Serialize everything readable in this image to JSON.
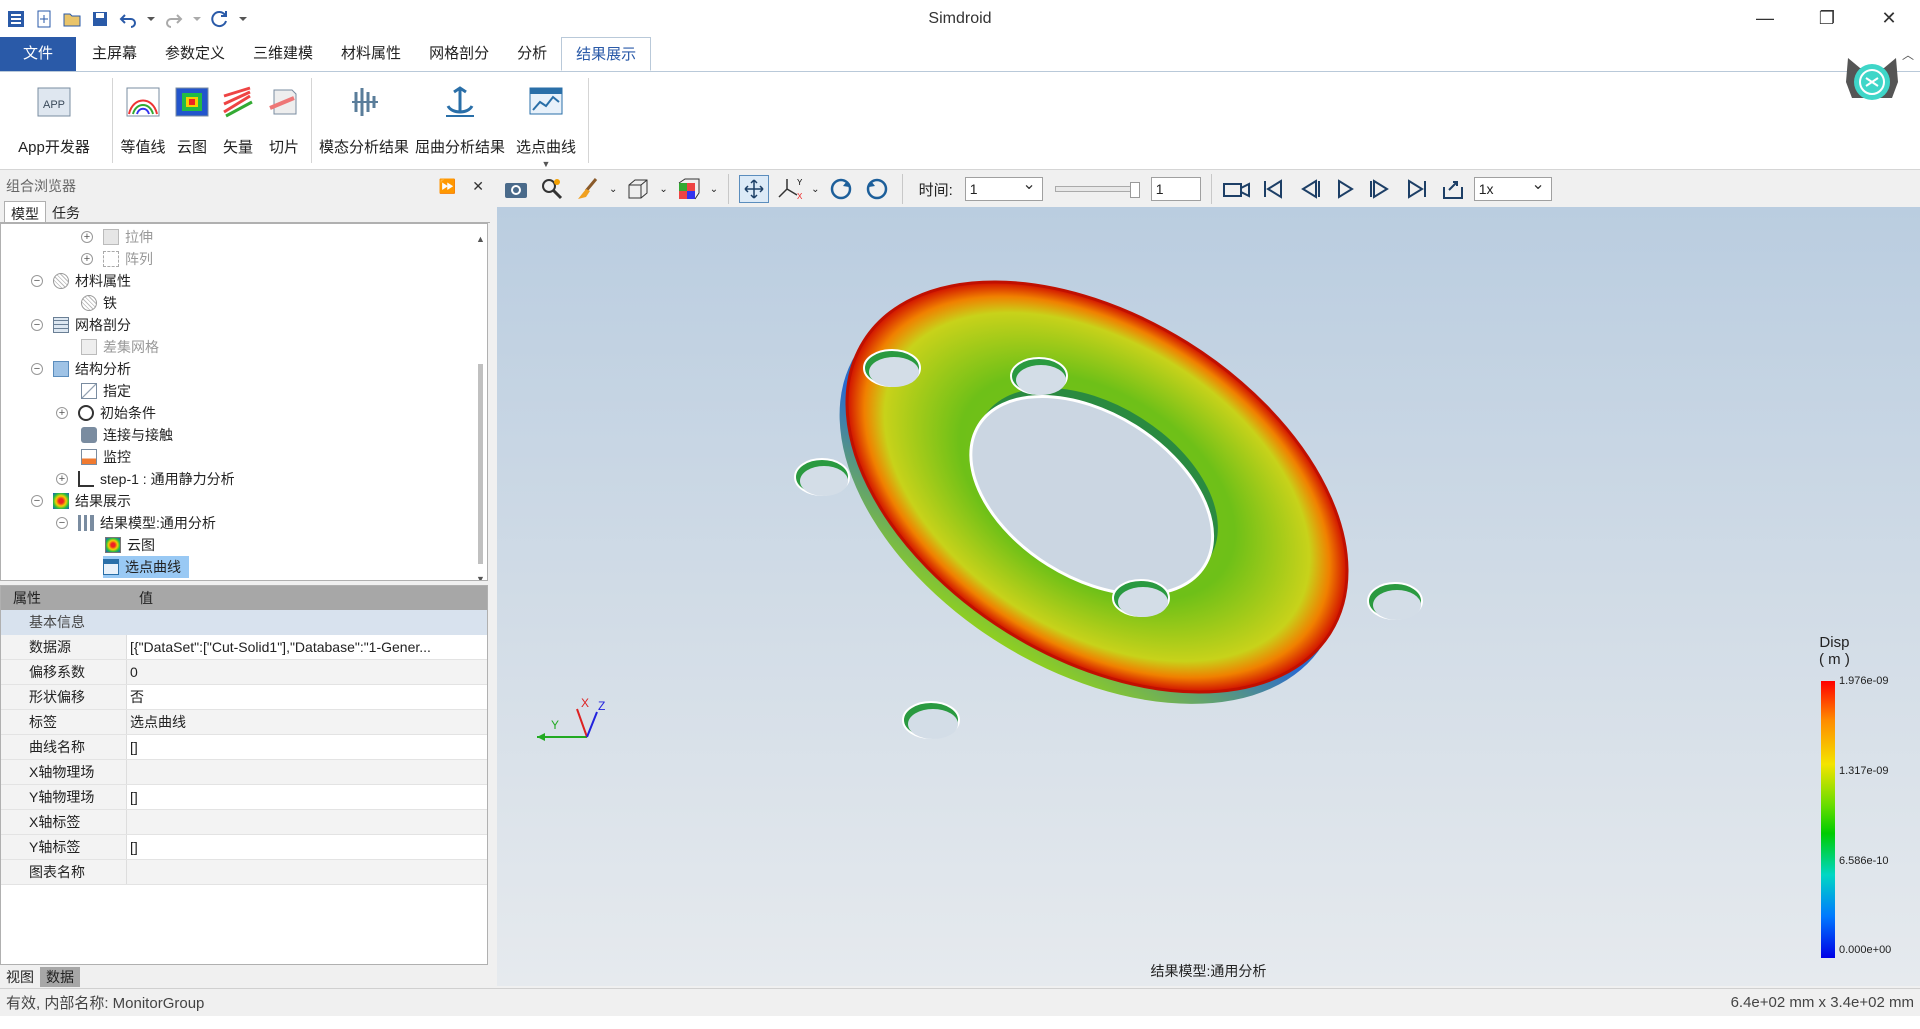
{
  "window": {
    "title": "Simdroid"
  },
  "menu_tabs": [
    "文件",
    "主屏幕",
    "参数定义",
    "三维建模",
    "材料属性",
    "网格剖分",
    "分析",
    "结果展示"
  ],
  "ribbon": {
    "buttons": [
      "App开发器",
      "等值线",
      "云图",
      "矢量",
      "切片",
      "模态分析结果",
      "屈曲分析结果",
      "选点曲线"
    ]
  },
  "left_panel": {
    "title": "组合浏览器",
    "tabs": [
      "模型",
      "任务"
    ],
    "tree": [
      {
        "label": "拉伸"
      },
      {
        "label": "阵列"
      },
      {
        "label": "材料属性"
      },
      {
        "label": "铁"
      },
      {
        "label": "网格剖分"
      },
      {
        "label": "差集网格"
      },
      {
        "label": "结构分析"
      },
      {
        "label": "指定"
      },
      {
        "label": "初始条件"
      },
      {
        "label": "连接与接触"
      },
      {
        "label": "监控"
      },
      {
        "label": "step-1 : 通用静力分析"
      },
      {
        "label": "结果展示"
      },
      {
        "label": "结果模型:通用分析"
      },
      {
        "label": "云图"
      },
      {
        "label": "选点曲线"
      }
    ],
    "props_header": [
      "属性",
      "值"
    ],
    "props_group": "基本信息",
    "props": [
      {
        "k": "数据源",
        "v": "[{\"DataSet\":[\"Cut-Solid1\"],\"Database\":\"1-Gener..."
      },
      {
        "k": "偏移系数",
        "v": "0"
      },
      {
        "k": "形状偏移",
        "v": "否"
      },
      {
        "k": "标签",
        "v": "选点曲线"
      },
      {
        "k": "曲线名称",
        "v": "[]"
      },
      {
        "k": "X轴物理场",
        "v": ""
      },
      {
        "k": "Y轴物理场",
        "v": "[]"
      },
      {
        "k": "X轴标签",
        "v": ""
      },
      {
        "k": "Y轴标签",
        "v": "[]"
      },
      {
        "k": "图表名称",
        "v": ""
      }
    ],
    "bottom_tabs": [
      "视图",
      "数据"
    ]
  },
  "viewer_toolbar": {
    "time_label": "时间:",
    "time_value": "1",
    "frame_value": "1",
    "speed": "1x"
  },
  "viewport": {
    "legend_title": "Disp",
    "legend_unit": "( m )",
    "legend_values": [
      "1.976e-09",
      "1.317e-09",
      "6.586e-10",
      "0.000e+00"
    ],
    "caption": "结果模型:通用分析",
    "axis_labels": [
      "X",
      "Y",
      "Z"
    ]
  },
  "status": {
    "left": "有效, 内部名称: MonitorGroup",
    "right": "6.4e+02 mm x 3.4e+02 mm"
  }
}
